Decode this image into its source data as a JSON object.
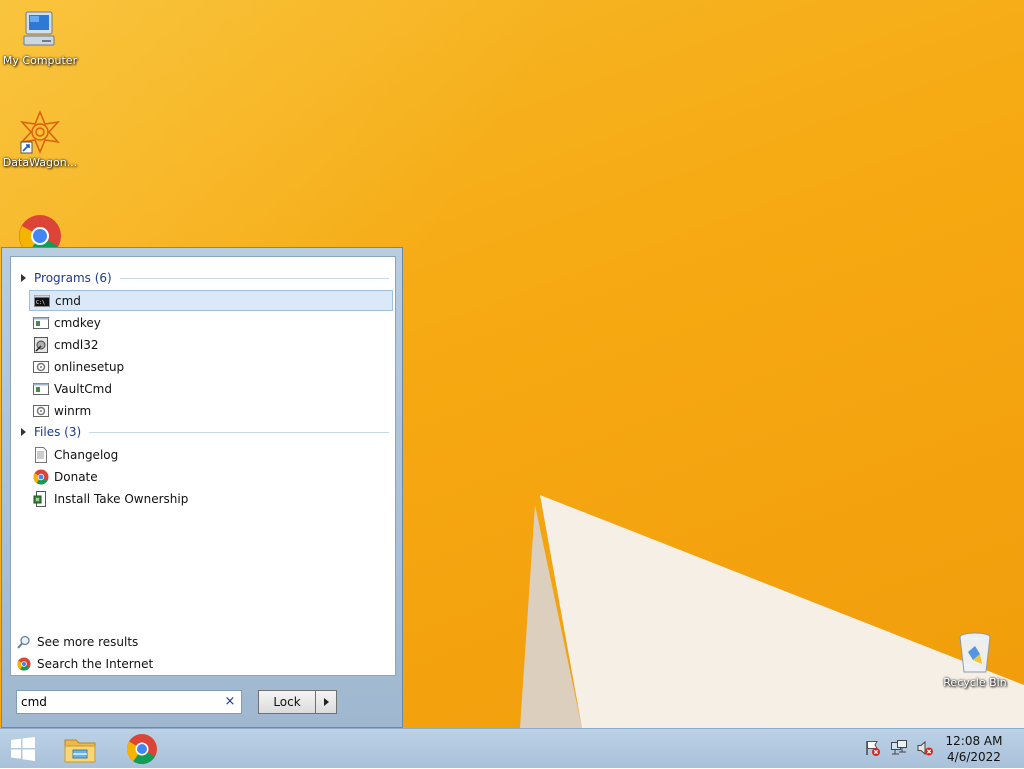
{
  "desktop": {
    "icons": [
      {
        "label": "My Computer",
        "icon": "computer-icon"
      },
      {
        "label": "DataWagon...",
        "icon": "datawagon-shortcut-icon"
      },
      {
        "label": "",
        "icon": "chrome-icon"
      },
      {
        "label": "Recycle Bin",
        "icon": "recycle-bin-icon"
      }
    ]
  },
  "start_menu": {
    "groups": [
      {
        "header": "Programs (6)",
        "items": [
          {
            "label": "cmd",
            "icon": "cmd-icon",
            "selected": true
          },
          {
            "label": "cmdkey",
            "icon": "window-app-icon"
          },
          {
            "label": "cmdl32",
            "icon": "cmdl32-icon"
          },
          {
            "label": "onlinesetup",
            "icon": "setup-icon"
          },
          {
            "label": "VaultCmd",
            "icon": "window-app-icon"
          },
          {
            "label": "winrm",
            "icon": "setup-icon"
          }
        ]
      },
      {
        "header": "Files (3)",
        "items": [
          {
            "label": "Changelog",
            "icon": "text-file-icon"
          },
          {
            "label": "Donate",
            "icon": "chrome-icon"
          },
          {
            "label": "Install Take Ownership",
            "icon": "registry-file-icon"
          }
        ]
      }
    ],
    "see_more": "See more results",
    "search_internet": "Search the Internet",
    "search": {
      "value": "cmd",
      "clear_symbol": "×"
    },
    "lock_button": "Lock"
  },
  "taskbar": {
    "apps": [
      "file-explorer-icon",
      "chrome-icon"
    ],
    "tray_icons": [
      "action-center-flag-icon",
      "network-icon",
      "volume-muted-icon"
    ],
    "clock": {
      "time": "12:08 AM",
      "date": "4/6/2022"
    }
  },
  "colors": {
    "wallpaper": "#f6a912",
    "taskbar": "#b4cbe2",
    "selection": "#dbe8f7",
    "group_header": "#1e3a8a"
  }
}
